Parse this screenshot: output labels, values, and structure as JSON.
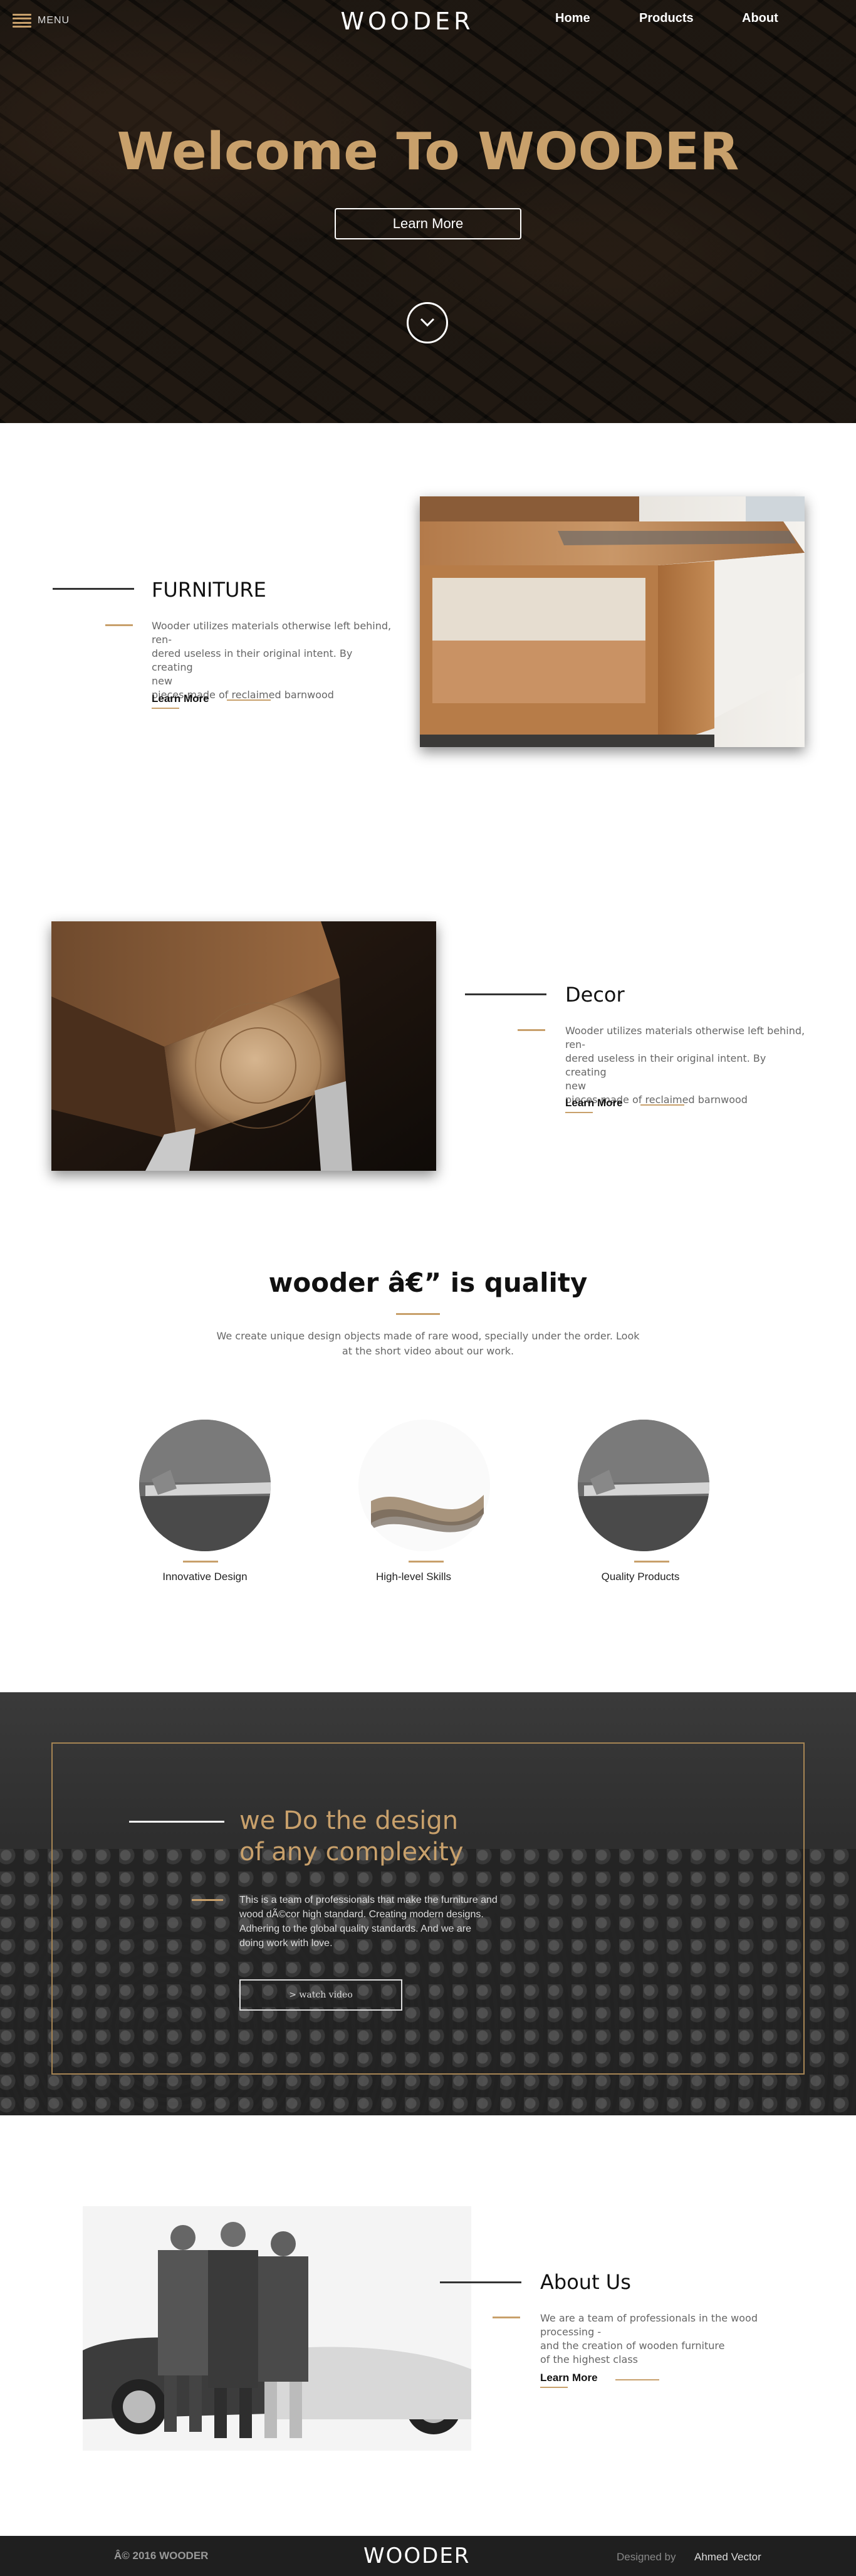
{
  "header": {
    "menu_label": "MENU",
    "logo": "WOODER",
    "nav": [
      "Home",
      "Products",
      "About"
    ]
  },
  "hero": {
    "title": "Welcome To WOODER",
    "button": "Learn More"
  },
  "furniture": {
    "title": "FURNITURE",
    "text_lines": [
      "Wooder utilizes materials otherwise left behind, ren-",
      "dered useless in their original intent. By creating",
      "new",
      "pieces made of reclaimed barnwood"
    ],
    "link": "Learn More"
  },
  "decor": {
    "title": "Decor",
    "text_lines": [
      "Wooder utilizes materials otherwise left behind, ren-",
      "dered useless in their original intent. By creating",
      "new",
      "pieces made of reclaimed barnwood"
    ],
    "link": "Learn More"
  },
  "quality": {
    "title": "wooder â€” is quality",
    "text": "We create unique design objects made of rare wood, specially under the order. Look at the short video about our work.",
    "items": [
      "Innovative Design",
      "High-level Skills",
      "Quality Products"
    ]
  },
  "design": {
    "title_lines": [
      "we Do the design",
      "of any complexity"
    ],
    "text_lines": [
      "This is a team of professionals that make the furniture and",
      "wood dÃ©cor high standard. Creating modern designs.",
      "Adhering to the global quality standards. And we are",
      "doing work with love."
    ],
    "button": "> watch video"
  },
  "about": {
    "title": "About Us",
    "text_lines": [
      "We are a team of professionals in the wood processing -",
      "and the creation of wooden furniture",
      "of the highest class"
    ],
    "link": "Learn More"
  },
  "footer": {
    "copyright": "Â© 2016 WOODER",
    "logo": "WOODER",
    "designed_by": "Designed by",
    "author": "Ahmed Vector"
  },
  "colors": {
    "accent": "#c8a06b",
    "dark": "#1f1f1f"
  }
}
